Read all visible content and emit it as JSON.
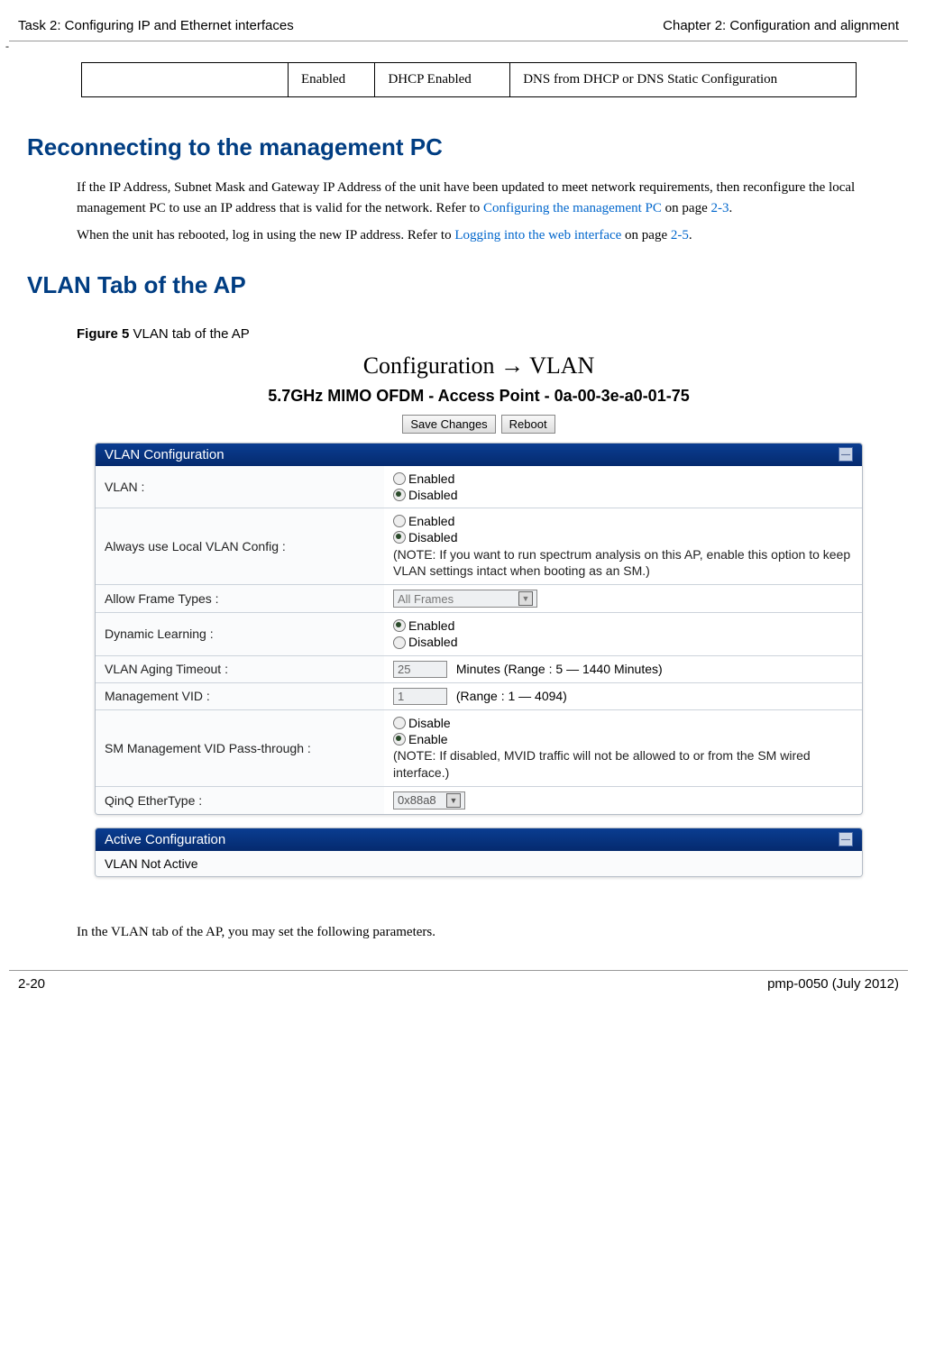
{
  "header": {
    "left": "Task 2: Configuring IP and Ethernet interfaces",
    "right": "Chapter 2:  Configuration and alignment",
    "dash": "-"
  },
  "mini_table": {
    "cells": [
      "",
      "Enabled",
      "DHCP Enabled",
      "DNS from DHCP or DNS Static Configuration"
    ]
  },
  "section1": {
    "heading": "Reconnecting to the management PC",
    "p1_a": "If the IP Address, Subnet Mask and Gateway IP Address of the unit have been updated to meet network requirements, then reconfigure the local management PC to use an IP address that is valid for the network. Refer to ",
    "p1_link1": "Configuring the management PC",
    "p1_b": " on page ",
    "p1_link2": "2-3",
    "p1_c": ".",
    "p2_a": "When the unit has rebooted, log in using the new IP address. Refer to ",
    "p2_link1": "Logging into the web interface",
    "p2_b": " on page ",
    "p2_link2": "2-5",
    "p2_c": "."
  },
  "section2": {
    "heading": "VLAN Tab of the AP",
    "fig_label": "Figure 5",
    "fig_caption": "  VLAN tab of the AP"
  },
  "ui": {
    "title": "Configuration → VLAN",
    "subtitle": "5.7GHz MIMO OFDM - Access Point - 0a-00-3e-a0-01-75",
    "btn_save": "Save Changes",
    "btn_reboot": "Reboot",
    "panel1_title": "VLAN Configuration",
    "panel2_title": "Active Configuration",
    "rows": {
      "vlan_label": "VLAN :",
      "vlan_opt1": "Enabled",
      "vlan_opt2": "Disabled",
      "alwcfg_label": "Always use Local VLAN Config :",
      "alwcfg_opt1": "Enabled",
      "alwcfg_opt2": "Disabled",
      "alwcfg_note": "(NOTE: If you want to run spectrum analysis on this AP, enable this option to keep VLAN settings intact when booting as an SM.)",
      "aft_label": "Allow Frame Types :",
      "aft_value": "All Frames",
      "dyn_label": "Dynamic Learning :",
      "dyn_opt1": "Enabled",
      "dyn_opt2": "Disabled",
      "aging_label": "VLAN Aging Timeout :",
      "aging_value": "25",
      "aging_suffix": "Minutes (Range : 5 — 1440 Minutes)",
      "mvid_label": "Management VID :",
      "mvid_value": "1",
      "mvid_suffix": "(Range : 1 — 4094)",
      "smvid_label": "SM Management VID Pass-through :",
      "smvid_opt1": "Disable",
      "smvid_opt2": "Enable",
      "smvid_note": "(NOTE: If disabled, MVID traffic will not be allowed to or from the SM wired interface.)",
      "qinq_label": "QinQ EtherType :",
      "qinq_value": "0x88a8"
    },
    "active_text": "VLAN Not Active"
  },
  "closing_para": "In the VLAN tab of the AP, you may set the following parameters.",
  "footer": {
    "left": "2-20",
    "right": "pmp-0050 (July 2012)"
  }
}
